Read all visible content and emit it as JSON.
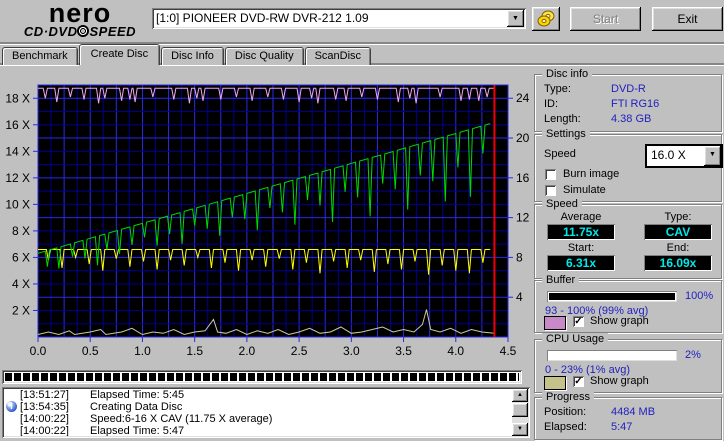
{
  "window": {
    "logo_line1": "nero",
    "logo_line2_left": "CD·DVD",
    "logo_line2_right": "SPEED",
    "drive_selector": "[1:0]   PIONEER DVD-RW  DVR-212 1.09",
    "start_label": "Start",
    "exit_label": "Exit"
  },
  "tabs": [
    {
      "id": "benchmark",
      "label": "Benchmark",
      "active": false
    },
    {
      "id": "create-disc",
      "label": "Create Disc",
      "active": true
    },
    {
      "id": "disc-info",
      "label": "Disc Info",
      "active": false
    },
    {
      "id": "disc-quality",
      "label": "Disc Quality",
      "active": false
    },
    {
      "id": "scandisc",
      "label": "ScanDisc",
      "active": false
    }
  ],
  "panel": {
    "disc_info": {
      "title": "Disc info",
      "rows": [
        {
          "label": "Type:",
          "value": "DVD-R"
        },
        {
          "label": "ID:",
          "value": "FTI RG16"
        },
        {
          "label": "Length:",
          "value": "4.38 GB"
        }
      ]
    },
    "settings": {
      "title": "Settings",
      "speed_label": "Speed",
      "speed_value": "16.0 X",
      "checkboxes": [
        {
          "label": "Burn image",
          "checked": false
        },
        {
          "label": "Simulate",
          "checked": false
        }
      ]
    },
    "speed": {
      "title": "Speed",
      "cells": [
        {
          "label": "Average",
          "value": "11.75x"
        },
        {
          "label": "Type:",
          "value": "CAV"
        },
        {
          "label": "Start:",
          "value": "6.31x"
        },
        {
          "label": "End:",
          "value": "16.09x"
        }
      ]
    },
    "buffer": {
      "title": "Buffer",
      "percent": 100,
      "percent_label": "100%",
      "range_text": "93 - 100% (99% avg)",
      "show_graph_label": "Show graph",
      "checked": true,
      "swatch_color": "#c989c9"
    },
    "cpu": {
      "title": "CPU Usage",
      "percent": 2,
      "percent_label": "2%",
      "range_text": "0 - 23% (1% avg)",
      "show_graph_label": "Show graph",
      "checked": true,
      "swatch_color": "#c6c38a"
    },
    "progress": {
      "title": "Progress",
      "rows": [
        {
          "label": "Position:",
          "value": "4484 MB"
        },
        {
          "label": "Elapsed:",
          "value": "5:47"
        }
      ]
    }
  },
  "log": {
    "entries": [
      {
        "time": "[13:51:27]",
        "text": "Elapsed Time:  5:45",
        "icon": false
      },
      {
        "time": "[13:54:35]",
        "text": "Creating Data Disc",
        "icon": true
      },
      {
        "time": "[14:00:22]",
        "text": "Speed:6-16 X CAV (11.75 X average)",
        "icon": false
      },
      {
        "time": "[14:00:22]",
        "text": "Elapsed Time:  5:47",
        "icon": false
      }
    ]
  },
  "chart_data": {
    "type": "line",
    "title": "",
    "x_range": [
      0,
      4.5
    ],
    "x_ticks": [
      {
        "v": 0,
        "label": "0.0"
      },
      {
        "v": 0.5,
        "label": "0.5"
      },
      {
        "v": 1,
        "label": "1.0"
      },
      {
        "v": 1.5,
        "label": "1.5"
      },
      {
        "v": 2,
        "label": "2.0"
      },
      {
        "v": 2.5,
        "label": "2.5"
      },
      {
        "v": 3,
        "label": "3.0"
      },
      {
        "v": 3.5,
        "label": "3.5"
      },
      {
        "v": 4,
        "label": "4.0"
      },
      {
        "v": 4.5,
        "label": "4.5"
      }
    ],
    "y_left": {
      "range": [
        0,
        19
      ],
      "ticks": [
        {
          "v": 2,
          "label": "2 X"
        },
        {
          "v": 4,
          "label": "4 X"
        },
        {
          "v": 6,
          "label": "6 X"
        },
        {
          "v": 8,
          "label": "8 X"
        },
        {
          "v": 10,
          "label": "10 X"
        },
        {
          "v": 12,
          "label": "12 X"
        },
        {
          "v": 14,
          "label": "14 X"
        },
        {
          "v": 16,
          "label": "16 X"
        },
        {
          "v": 18,
          "label": "18 X"
        }
      ]
    },
    "y_right": {
      "range": [
        0,
        25.33
      ],
      "ticks": [
        {
          "v": 4,
          "label": "4"
        },
        {
          "v": 8,
          "label": "8"
        },
        {
          "v": 12,
          "label": "12"
        },
        {
          "v": 16,
          "label": "16"
        },
        {
          "v": 20,
          "label": "20"
        },
        {
          "v": 24,
          "label": "24"
        }
      ]
    },
    "grid": {
      "minor_color": "#00008f",
      "major_color": "#2a2ae6",
      "background": "#000000"
    },
    "series": [
      {
        "name": "buffer-level",
        "color": "#f0a6f0",
        "axis": "percent",
        "flat": 99.5,
        "start_x": 0,
        "end_x": 4.37,
        "dips": [
          [
            0.07,
            4
          ],
          [
            0.18,
            5.5
          ],
          [
            0.31,
            3.5
          ],
          [
            0.44,
            4.5
          ],
          [
            0.58,
            6
          ],
          [
            0.64,
            4
          ],
          [
            0.8,
            5
          ],
          [
            0.88,
            4.5
          ],
          [
            0.93,
            5.5
          ],
          [
            1.1,
            3.5
          ],
          [
            1.3,
            4.5
          ],
          [
            1.45,
            6
          ],
          [
            1.52,
            4
          ],
          [
            1.58,
            5
          ],
          [
            1.75,
            4.5
          ],
          [
            1.9,
            3.5
          ],
          [
            2.05,
            5
          ],
          [
            2.2,
            3.5
          ],
          [
            2.35,
            4.5
          ],
          [
            2.5,
            5.5
          ],
          [
            2.62,
            4
          ],
          [
            2.68,
            6
          ],
          [
            2.85,
            4.5
          ],
          [
            2.95,
            5
          ],
          [
            3.1,
            3.5
          ],
          [
            3.25,
            4.5
          ],
          [
            3.45,
            5.5
          ],
          [
            3.56,
            4
          ],
          [
            3.62,
            6
          ],
          [
            3.85,
            3.5
          ],
          [
            4.05,
            5
          ],
          [
            4.13,
            4.5
          ],
          [
            4.22,
            5
          ],
          [
            4.3,
            3.5
          ]
        ]
      },
      {
        "name": "cpu-usage",
        "color": "#cfcb92",
        "axis": "percent",
        "points": [
          [
            0,
            1
          ],
          [
            0.1,
            2
          ],
          [
            0.2,
            1
          ],
          [
            0.3,
            2.5
          ],
          [
            0.35,
            1
          ],
          [
            0.5,
            2
          ],
          [
            0.6,
            3
          ],
          [
            0.65,
            1
          ],
          [
            0.8,
            2
          ],
          [
            0.9,
            3.5
          ],
          [
            1.0,
            1
          ],
          [
            1.1,
            2
          ],
          [
            1.2,
            1.5
          ],
          [
            1.3,
            3
          ],
          [
            1.4,
            1
          ],
          [
            1.5,
            2
          ],
          [
            1.6,
            2.5
          ],
          [
            1.68,
            7
          ],
          [
            1.72,
            2
          ],
          [
            1.8,
            1.5
          ],
          [
            1.9,
            3
          ],
          [
            2.0,
            1
          ],
          [
            2.1,
            2.5
          ],
          [
            2.2,
            1.5
          ],
          [
            2.3,
            3
          ],
          [
            2.4,
            1
          ],
          [
            2.5,
            2
          ],
          [
            2.6,
            3.5
          ],
          [
            2.7,
            1.5
          ],
          [
            2.8,
            2
          ],
          [
            2.9,
            4
          ],
          [
            3.0,
            1.5
          ],
          [
            3.1,
            2
          ],
          [
            3.2,
            3
          ],
          [
            3.3,
            4
          ],
          [
            3.4,
            2
          ],
          [
            3.5,
            3
          ],
          [
            3.6,
            2
          ],
          [
            3.68,
            5
          ],
          [
            3.72,
            11
          ],
          [
            3.76,
            3
          ],
          [
            3.85,
            2
          ],
          [
            3.95,
            3.5
          ],
          [
            4.05,
            1.5
          ],
          [
            4.15,
            3
          ],
          [
            4.25,
            2
          ],
          [
            4.37,
            1.5
          ]
        ]
      },
      {
        "name": "secondary-speed",
        "color": "#ffff00",
        "axis": "left",
        "flat": 6.6,
        "start_x": 0,
        "end_x": 4.33,
        "dips": [
          [
            0.1,
            0.8
          ],
          [
            0.23,
            1.4
          ],
          [
            0.36,
            0.6
          ],
          [
            0.49,
            1.1
          ],
          [
            0.62,
            1.6
          ],
          [
            0.75,
            0.7
          ],
          [
            0.88,
            1.3
          ],
          [
            1.01,
            0.9
          ],
          [
            1.14,
            1.5
          ],
          [
            1.27,
            0.8
          ],
          [
            1.4,
            1.2
          ],
          [
            1.53,
            0.6
          ],
          [
            1.66,
            1.4
          ],
          [
            1.79,
            1.0
          ],
          [
            1.92,
            1.6
          ],
          [
            2.05,
            0.8
          ],
          [
            2.18,
            1.3
          ],
          [
            2.31,
            0.7
          ],
          [
            2.44,
            1.5
          ],
          [
            2.57,
            1.0
          ],
          [
            2.7,
            1.8
          ],
          [
            2.83,
            0.9
          ],
          [
            2.96,
            1.4
          ],
          [
            3.09,
            0.8
          ],
          [
            3.22,
            1.7
          ],
          [
            3.35,
            1.1
          ],
          [
            3.48,
            1.5
          ],
          [
            3.61,
            0.9
          ],
          [
            3.74,
            1.9
          ],
          [
            3.87,
            1.2
          ],
          [
            4.0,
            1.6
          ],
          [
            4.13,
            1.8
          ],
          [
            4.26,
            1.0
          ]
        ]
      },
      {
        "name": "write-speed",
        "color": "#00d800",
        "axis": "left",
        "start_x": 0,
        "start_y": 6.31,
        "end_x": 4.33,
        "end_y": 16.09,
        "dips": [
          [
            0.09,
            1.2
          ],
          [
            0.2,
            1.6
          ],
          [
            0.33,
            1.0
          ],
          [
            0.45,
            1.4
          ],
          [
            0.57,
            2.2
          ],
          [
            0.66,
            1.2
          ],
          [
            0.78,
            1.8
          ],
          [
            0.9,
            1.4
          ],
          [
            1.02,
            1.1
          ],
          [
            1.14,
            2.0
          ],
          [
            1.26,
            1.4
          ],
          [
            1.38,
            2.4
          ],
          [
            1.5,
            1.3
          ],
          [
            1.62,
            1.8
          ],
          [
            1.74,
            2.6
          ],
          [
            1.86,
            1.5
          ],
          [
            1.98,
            1.9
          ],
          [
            2.1,
            3.0
          ],
          [
            2.22,
            1.6
          ],
          [
            2.34,
            2.2
          ],
          [
            2.46,
            3.4
          ],
          [
            2.58,
            1.8
          ],
          [
            2.7,
            2.5
          ],
          [
            2.82,
            4.0
          ],
          [
            2.94,
            2.0
          ],
          [
            3.06,
            2.7
          ],
          [
            3.18,
            4.4
          ],
          [
            3.3,
            2.2
          ],
          [
            3.42,
            2.9
          ],
          [
            3.54,
            4.7
          ],
          [
            3.66,
            2.4
          ],
          [
            3.78,
            3.1
          ],
          [
            3.9,
            4.9
          ],
          [
            4.02,
            2.6
          ],
          [
            4.14,
            5.1
          ],
          [
            4.26,
            2.1
          ]
        ]
      }
    ],
    "end_marker": {
      "x": 4.37,
      "color": "#f00000"
    },
    "summary": {
      "write_speed_start": 6.31,
      "write_speed_end": 16.09,
      "write_speed_average": 11.75,
      "write_type": "CAV",
      "buffer_range_pct": [
        93,
        100
      ],
      "cpu_range_pct": [
        0,
        23
      ]
    }
  }
}
